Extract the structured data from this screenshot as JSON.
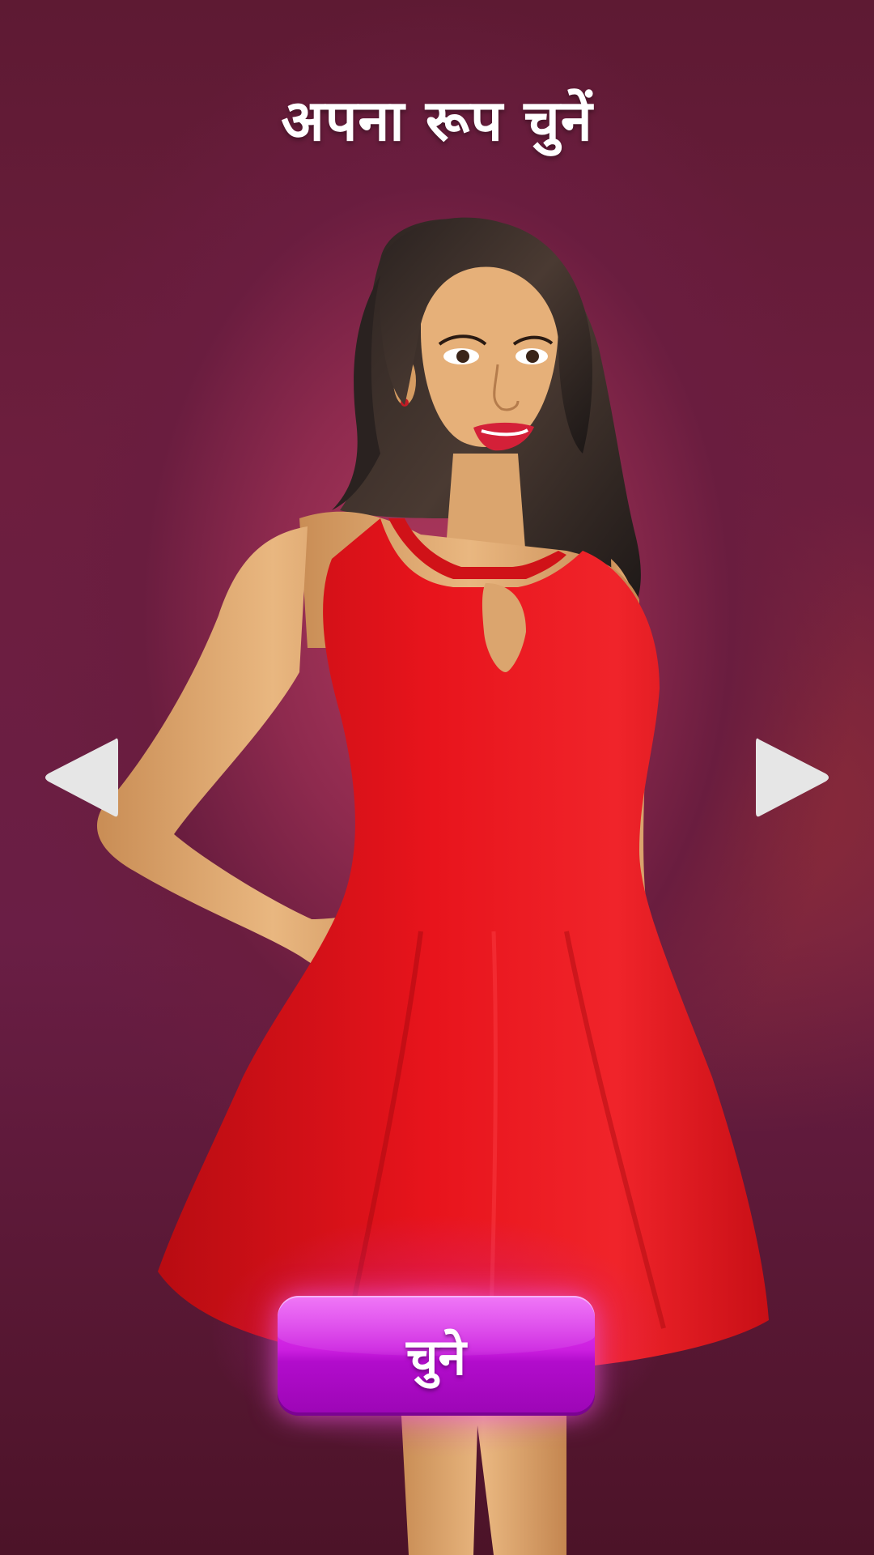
{
  "screen": {
    "title": "अपना रूप चुनें"
  },
  "character_carousel": {
    "selected_character": "woman in red halter dress",
    "prev_icon": "triangle-left-icon",
    "next_icon": "triangle-right-icon"
  },
  "select_button": {
    "label": "चुने"
  },
  "colors": {
    "background": "#7a2245",
    "button_accent": "#c316d9",
    "dress": "#e0141c",
    "arrow": "#e8e8e8",
    "title": "#ffffff"
  }
}
